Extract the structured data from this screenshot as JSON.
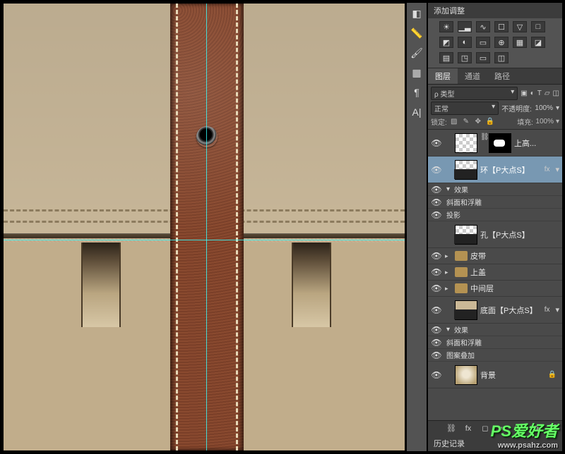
{
  "adjustments": {
    "title": "添加调整"
  },
  "tabs": {
    "layers": "图层",
    "channels": "通道",
    "paths": "路径"
  },
  "layer_opts": {
    "kind": "类型",
    "blend": "正常",
    "opacity_label": "不透明度:",
    "opacity_value": "100%",
    "lock_label": "锁定:",
    "fill_label": "填充:",
    "fill_value": "100%"
  },
  "layers": {
    "l0": "上高...",
    "l1": "环【P大点S】",
    "eff": "效果",
    "bevel": "斜面和浮雕",
    "shadow": "投影",
    "l2": "孔【P大点S】",
    "g0": "皮带",
    "g1": "上盖",
    "g2": "中间层",
    "l3": "底面【P大点S】",
    "pattern": "图案叠加",
    "bg": "背景"
  },
  "history": {
    "title": "历史记录"
  },
  "fx": "fx",
  "chev": "▾",
  "tri_r": "▸",
  "tri_d": "▾",
  "eye": "👁",
  "watermark": {
    "main": "PS爱好者",
    "sub": "www.psahz.com"
  }
}
